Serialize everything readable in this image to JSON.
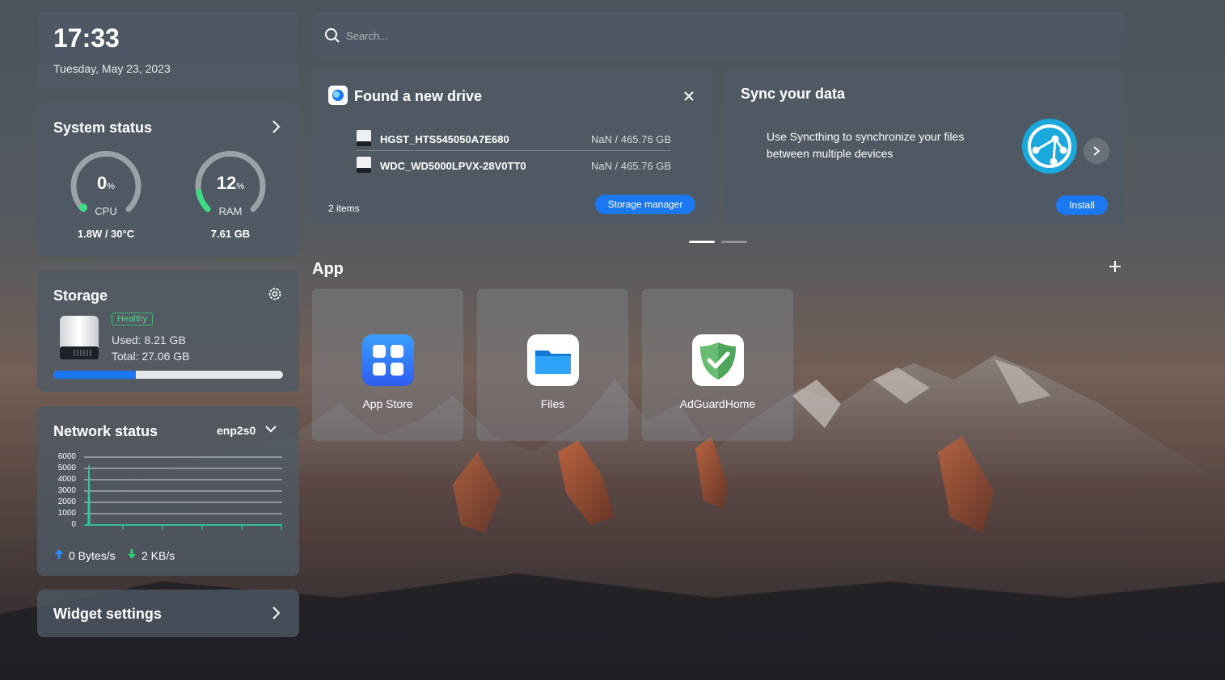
{
  "clock": {
    "time": "17:33",
    "date": "Tuesday, May 23, 2023"
  },
  "system_status": {
    "title": "System status",
    "cpu": {
      "value": "0",
      "unit": "%",
      "label": "CPU",
      "detail": "1.8W / 30°C",
      "percent": 0
    },
    "ram": {
      "value": "12",
      "unit": "%",
      "label": "RAM",
      "detail": "7.61 GB",
      "percent": 12
    }
  },
  "storage": {
    "title": "Storage",
    "health": "Healthy",
    "used": "Used: 8.21 GB",
    "total": "Total: 27.06 GB",
    "used_fraction": 0.36
  },
  "network": {
    "title": "Network status",
    "interface": "enp2s0",
    "y_ticks": [
      "6000",
      "5000",
      "4000",
      "3000",
      "2000",
      "1000",
      "0"
    ],
    "upload": "0 Bytes/s",
    "download": "2 KB/s",
    "colors": {
      "upload": "#2f8cff",
      "download": "#2ecc71",
      "line": "#2ecc9a"
    }
  },
  "widget_settings": {
    "label": "Widget settings"
  },
  "search": {
    "placeholder": "Search..."
  },
  "drive_card": {
    "title": "Found a new drive",
    "drives": [
      {
        "name": "HGST_HTS545050A7E680",
        "size": "NaN / 465.76 GB"
      },
      {
        "name": "WDC_WD5000LPVX-28V0TT0",
        "size": "NaN / 465.76 GB"
      }
    ],
    "count": "2 items",
    "button": "Storage manager"
  },
  "sync_card": {
    "title": "Sync your data",
    "line1": "Use Syncthing to synchronize your files",
    "line2": "between multiple devices",
    "button": "Install"
  },
  "apps": {
    "title": "App",
    "items": [
      {
        "name": "App Store",
        "icon": "app-store-icon"
      },
      {
        "name": "Files",
        "icon": "folder-icon"
      },
      {
        "name": "AdGuardHome",
        "icon": "adguard-shield-icon"
      }
    ]
  },
  "colors": {
    "accent": "#1c78f0",
    "healthy": "#4cd98a",
    "gauge_active": "#3ddc84",
    "gauge_track": "#9aa1a8"
  }
}
